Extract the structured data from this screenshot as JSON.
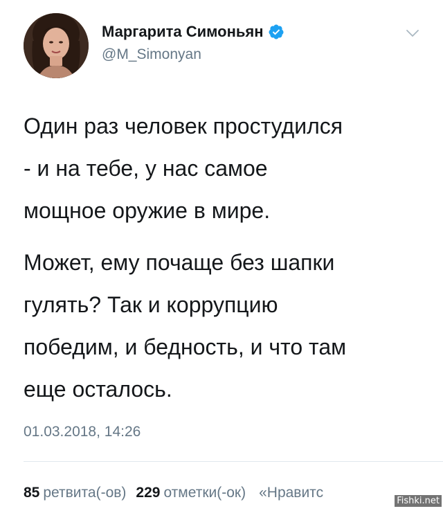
{
  "author": {
    "display_name": "Маргарита Симоньян",
    "handle": "@M_Simonyan",
    "verified": true
  },
  "tweet": {
    "paragraphs": [
      [
        "Один раз человек простудился",
        "- и на тебе, у нас самое",
        "мощное оружие в мире."
      ],
      [
        "Может, ему почаще без шапки",
        "гулять? Так и коррупцию",
        "победим, и бедность, и что там",
        "еще осталось."
      ]
    ],
    "timestamp": "01.03.2018, 14:26"
  },
  "stats": {
    "retweets_count": "85",
    "retweets_label": "ретвита(-ов)",
    "likes_count": "229",
    "likes_label": "отметки(-ок)",
    "more_label": "«Нравитс"
  },
  "watermark": "Fishki.net",
  "colors": {
    "text": "#14171a",
    "secondary": "#657786",
    "verified": "#1da1f2",
    "divider": "#e1e8ed"
  },
  "icons": {
    "verified": "verified-badge-icon",
    "caret": "chevron-down-icon"
  }
}
